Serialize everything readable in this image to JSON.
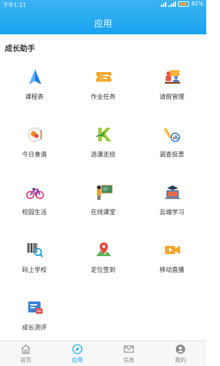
{
  "status_bar": {
    "time": "下午1:11",
    "battery": "81%",
    "battery_level": 0.81
  },
  "header": {
    "title": "应用"
  },
  "section": {
    "title": "成长助手"
  },
  "apps": [
    {
      "label": "课程表",
      "icon": "navigation-triangle-icon"
    },
    {
      "label": "作业任务",
      "icon": "ticket-icon"
    },
    {
      "label": "请假管理",
      "icon": "people-meeting-icon"
    },
    {
      "label": "今日食谱",
      "icon": "food-plate-icon"
    },
    {
      "label": "选课走班",
      "icon": "letter-k-icon"
    },
    {
      "label": "调查投票",
      "icon": "pencil-chart-icon"
    },
    {
      "label": "校园生活",
      "icon": "bicycle-icon"
    },
    {
      "label": "在线课堂",
      "icon": "teacher-blackboard-icon"
    },
    {
      "label": "云端学习",
      "icon": "laptop-graduation-icon"
    },
    {
      "label": "码上学校",
      "icon": "barcode-search-icon"
    },
    {
      "label": "定位签到",
      "icon": "map-pin-icon"
    },
    {
      "label": "移动直播",
      "icon": "video-camera-icon"
    },
    {
      "label": "成长测评",
      "icon": "report-card-icon"
    }
  ],
  "tabs": [
    {
      "label": "首页",
      "icon": "home-icon"
    },
    {
      "label": "应用",
      "icon": "compass-icon"
    },
    {
      "label": "信息",
      "icon": "mail-icon"
    },
    {
      "label": "我的",
      "icon": "user-icon"
    }
  ],
  "colors": {
    "accent": "#1aa3ef",
    "header_top": "#3cb3f4"
  }
}
